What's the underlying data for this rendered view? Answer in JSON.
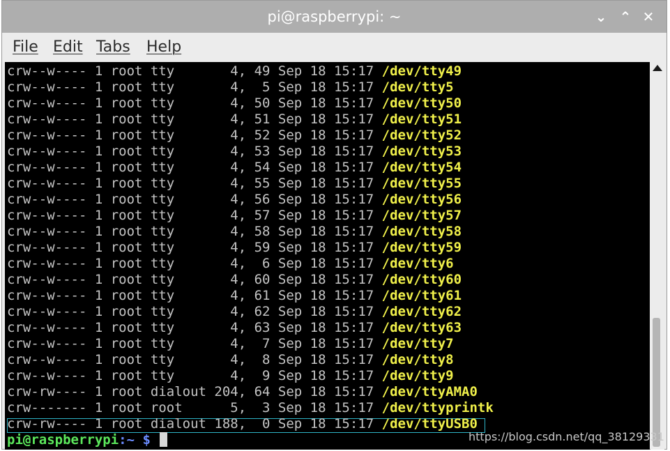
{
  "window": {
    "title": "pi@raspberrypi: ~",
    "buttons": [
      {
        "name": "minimize",
        "glyph": "⌄"
      },
      {
        "name": "maximize",
        "glyph": "⌃"
      },
      {
        "name": "close",
        "glyph": "✕"
      }
    ]
  },
  "menu": {
    "file": "File",
    "edit": "Edit",
    "tabs": "Tabs",
    "help": "Help"
  },
  "terminal": {
    "lines": [
      {
        "meta": "crw--w---- 1 root tty       4, 49 Sep 18 15:17 ",
        "path": "/dev/tty49"
      },
      {
        "meta": "crw--w---- 1 root tty       4,  5 Sep 18 15:17 ",
        "path": "/dev/tty5"
      },
      {
        "meta": "crw--w---- 1 root tty       4, 50 Sep 18 15:17 ",
        "path": "/dev/tty50"
      },
      {
        "meta": "crw--w---- 1 root tty       4, 51 Sep 18 15:17 ",
        "path": "/dev/tty51"
      },
      {
        "meta": "crw--w---- 1 root tty       4, 52 Sep 18 15:17 ",
        "path": "/dev/tty52"
      },
      {
        "meta": "crw--w---- 1 root tty       4, 53 Sep 18 15:17 ",
        "path": "/dev/tty53"
      },
      {
        "meta": "crw--w---- 1 root tty       4, 54 Sep 18 15:17 ",
        "path": "/dev/tty54"
      },
      {
        "meta": "crw--w---- 1 root tty       4, 55 Sep 18 15:17 ",
        "path": "/dev/tty55"
      },
      {
        "meta": "crw--w---- 1 root tty       4, 56 Sep 18 15:17 ",
        "path": "/dev/tty56"
      },
      {
        "meta": "crw--w---- 1 root tty       4, 57 Sep 18 15:17 ",
        "path": "/dev/tty57"
      },
      {
        "meta": "crw--w---- 1 root tty       4, 58 Sep 18 15:17 ",
        "path": "/dev/tty58"
      },
      {
        "meta": "crw--w---- 1 root tty       4, 59 Sep 18 15:17 ",
        "path": "/dev/tty59"
      },
      {
        "meta": "crw--w---- 1 root tty       4,  6 Sep 18 15:17 ",
        "path": "/dev/tty6"
      },
      {
        "meta": "crw--w---- 1 root tty       4, 60 Sep 18 15:17 ",
        "path": "/dev/tty60"
      },
      {
        "meta": "crw--w---- 1 root tty       4, 61 Sep 18 15:17 ",
        "path": "/dev/tty61"
      },
      {
        "meta": "crw--w---- 1 root tty       4, 62 Sep 18 15:17 ",
        "path": "/dev/tty62"
      },
      {
        "meta": "crw--w---- 1 root tty       4, 63 Sep 18 15:17 ",
        "path": "/dev/tty63"
      },
      {
        "meta": "crw--w---- 1 root tty       4,  7 Sep 18 15:17 ",
        "path": "/dev/tty7"
      },
      {
        "meta": "crw--w---- 1 root tty       4,  8 Sep 18 15:17 ",
        "path": "/dev/tty8"
      },
      {
        "meta": "crw--w---- 1 root tty       4,  9 Sep 18 15:17 ",
        "path": "/dev/tty9"
      },
      {
        "meta": "crw-rw---- 1 root dialout 204, 64 Sep 18 15:17 ",
        "path": "/dev/ttyAMA0"
      },
      {
        "meta": "crw------- 1 root root      5,  3 Sep 18 15:17 ",
        "path": "/dev/ttyprintk"
      },
      {
        "meta": "crw-rw---- 1 root dialout 188,  0 Sep 18 15:17 ",
        "path": "/dev/ttyUSB0"
      }
    ],
    "prompt_user": "pi@raspberrypi",
    "prompt_path": ":~ $ "
  },
  "watermark": "https://blog.csdn.net/qq_38129331",
  "colors": {
    "titlebar": "#aeaeae",
    "device_path": "#f0f04a",
    "prompt_user": "#5ce85c",
    "prompt_path": "#6b8cff",
    "selection_border": "#2fb5c8"
  }
}
